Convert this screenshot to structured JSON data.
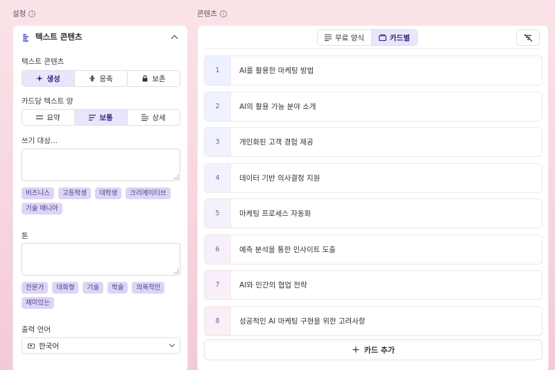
{
  "settings": {
    "label": "설정",
    "panel_title": "텍스트 콘텐츠",
    "text_content": {
      "label": "텍스트 콘텐츠",
      "options": [
        {
          "label": "생성",
          "icon": "sparkle-icon",
          "active": true
        },
        {
          "label": "응축",
          "icon": "condense-icon",
          "active": false
        },
        {
          "label": "보존",
          "icon": "lock-icon",
          "active": false
        }
      ]
    },
    "text_amount": {
      "label": "카드당 텍스트 양",
      "options": [
        {
          "label": "요약",
          "icon": "lines-short-icon",
          "active": false
        },
        {
          "label": "보통",
          "icon": "lines-medium-icon",
          "active": true
        },
        {
          "label": "상세",
          "icon": "lines-long-icon",
          "active": false
        }
      ]
    },
    "audience": {
      "label": "쓰기 대상...",
      "value": "",
      "chips": [
        "비즈니스",
        "고등학생",
        "대학생",
        "크리에이티브",
        "기술 매니아"
      ]
    },
    "tone": {
      "label": "톤",
      "value": "",
      "chips": [
        "전문가",
        "대화형",
        "기술",
        "학술",
        "의욕적인",
        "재미있는"
      ]
    },
    "language": {
      "label": "출력 언어",
      "value": "한국어"
    }
  },
  "content": {
    "label": "콘텐츠",
    "view_options": [
      {
        "label": "무료 양식",
        "icon": "free-form-icon",
        "active": false
      },
      {
        "label": "카드별",
        "icon": "card-icon",
        "active": true
      }
    ],
    "cards": [
      {
        "num": "1",
        "text": "AI를 활용한 마케팅 방법"
      },
      {
        "num": "2",
        "text": "AI의 활용 가능 분야 소개"
      },
      {
        "num": "3",
        "text": "개인화된 고객 경험 제공"
      },
      {
        "num": "4",
        "text": "데이터 기반 의사결정 지원"
      },
      {
        "num": "5",
        "text": "마케팅 프로세스 자동화"
      },
      {
        "num": "6",
        "text": "예측 분석을 통한 인사이트 도출"
      },
      {
        "num": "7",
        "text": "AI와 인간의 협업 전략"
      },
      {
        "num": "8",
        "text": "성공적인 AI 마케팅 구현을 위한 고려사항"
      }
    ],
    "add_card_label": "카드 추가"
  },
  "colors": {
    "accent": "#5b5fd6",
    "active_bg": "#e9e6fb",
    "chip_bg": "#ddd4f6"
  }
}
